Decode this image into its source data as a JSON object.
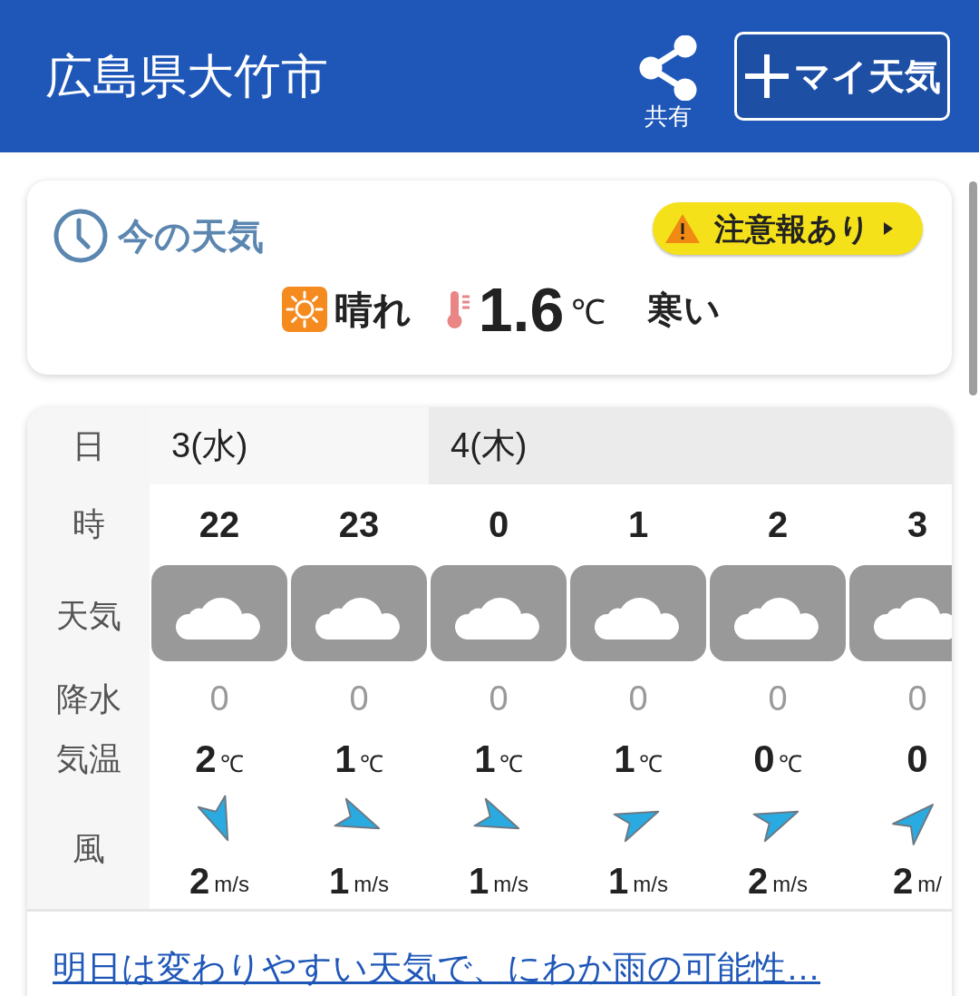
{
  "header": {
    "title": "広島県大竹市",
    "share_label": "共有",
    "my_weather_button": "マイ天気"
  },
  "current": {
    "title": "今の天気",
    "alert_badge": "注意報あり",
    "weather": "晴れ",
    "kind": "sunny",
    "temperature": "1.6",
    "temperature_unit": "℃",
    "feeling": "寒い"
  },
  "forecast": {
    "row_labels": [
      "日",
      "時",
      "天気",
      "降水",
      "気温",
      "風"
    ],
    "days": [
      {
        "label": "3(水)",
        "hours": [
          {
            "hour": "22",
            "kind": "cloudy",
            "precip": "0",
            "temp": "2",
            "temp_unit": "℃",
            "wind_arrow": {
              "kind": "NNW"
            },
            "wind_speed": "2",
            "wind_unit": "m/s"
          },
          {
            "hour": "23",
            "kind": "cloudy",
            "precip": "0",
            "temp": "1",
            "temp_unit": "℃",
            "wind_arrow": {
              "kind": "WNW"
            },
            "wind_speed": "1",
            "wind_unit": "m/s"
          }
        ]
      },
      {
        "label": "4(木)",
        "hours": [
          {
            "hour": "0",
            "kind": "cloudy",
            "precip": "0",
            "temp": "1",
            "temp_unit": "℃",
            "wind_arrow": {
              "kind": "WNW"
            },
            "wind_speed": "1",
            "wind_unit": "m/s"
          },
          {
            "hour": "1",
            "kind": "cloudy",
            "precip": "0",
            "temp": "1",
            "temp_unit": "℃",
            "wind_arrow": {
              "kind": "WSW"
            },
            "wind_speed": "1",
            "wind_unit": "m/s"
          },
          {
            "hour": "2",
            "kind": "cloudy",
            "precip": "0",
            "temp": "0",
            "temp_unit": "℃",
            "wind_arrow": {
              "kind": "WSW"
            },
            "wind_speed": "2",
            "wind_unit": "m/s"
          },
          {
            "hour": "3",
            "kind": "cloudy",
            "precip": "0",
            "temp": "0",
            "wind_arrow": {
              "kind": "SW"
            },
            "wind_speed": "2",
            "wind_unit": "m/"
          }
        ]
      }
    ]
  },
  "summary_link": "明日は変わりやすい天気で、にわか雨の可能性…"
}
